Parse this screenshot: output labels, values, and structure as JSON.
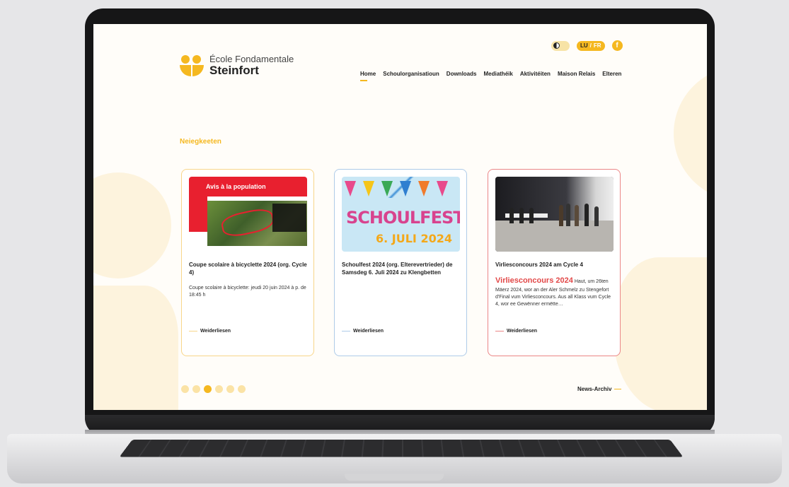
{
  "logo": {
    "line1": "École Fondamentale",
    "line2": "Steinfort"
  },
  "toolbar": {
    "lang_lu": "LU",
    "lang_fr": "FR",
    "facebook": "f"
  },
  "nav": {
    "items": [
      "Home",
      "Schoulorganisatioun",
      "Downloads",
      "Mediathéik",
      "Aktivitéiten",
      "Maison Relais",
      "Elteren"
    ],
    "active": "Home"
  },
  "section": {
    "title": "Neiegkeeten"
  },
  "cards": [
    {
      "image_text": "Avis à la population",
      "title": "Coupe scolaire à bicyclette 2024 (org. Cycle 4)",
      "text": "Coupe scolaire à bicyclette: jeudi 20 juin 2024 à p. de 18:45 h",
      "more": "Weiderliesen",
      "accent": "#f8d68a"
    },
    {
      "image_line1": "SCHOULFEST",
      "image_line2": "6. JULI 2024",
      "title": "Schoulfest 2024 (org. Elterevertrieder) de Samsdeg 6. Juli 2024 zu Klengbetten",
      "text": "",
      "more": "Weiderliesen",
      "accent": "#aecbe8"
    },
    {
      "title": "Virliesconcours 2024 am Cycle 4",
      "highlight": "Virliesconcours 2024",
      "text": "Haut, um 26ten Mäerz 2024, wor an der Aler Schmelz zu Stengefort d'Final vum Virliesconcours. Aus all Klass vum Cycle 4, wor ee Gewënner ermëtte…",
      "more": "Weiderliesen",
      "accent": "#eb8787"
    }
  ],
  "pagination": {
    "count": 6,
    "active_index": 2
  },
  "archive": {
    "label": "News-Archiv"
  },
  "colors": {
    "brand": "#f5b820",
    "red": "#e24848"
  }
}
